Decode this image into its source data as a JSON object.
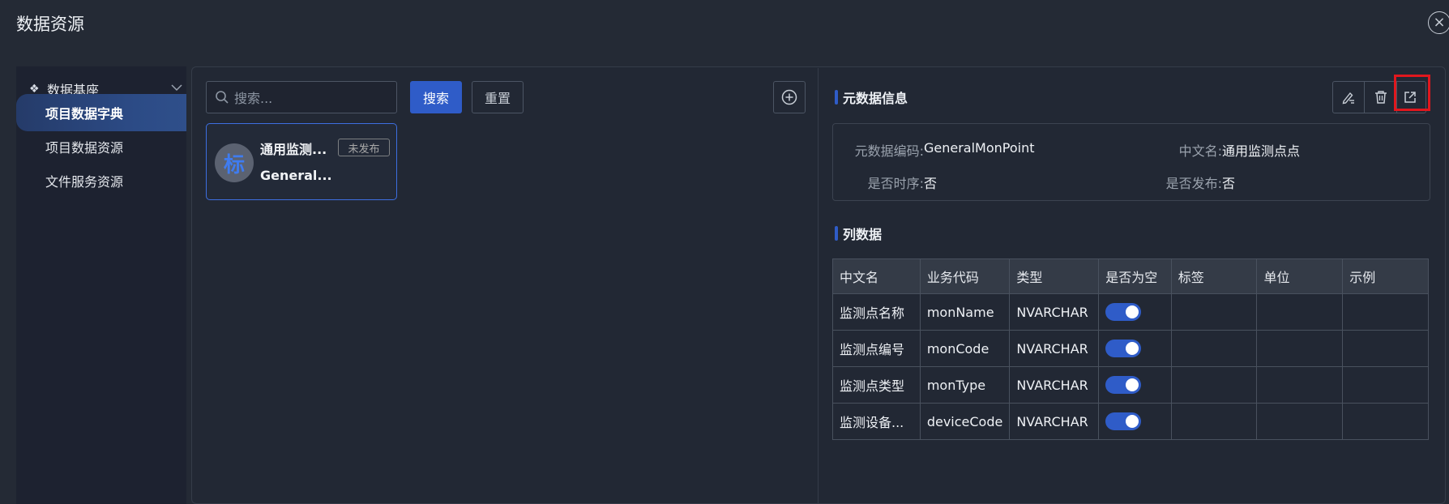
{
  "window": {
    "title": "数据资源"
  },
  "sidebar": {
    "header": "数据基座",
    "items": [
      {
        "label": "项目数据字典",
        "active": true
      },
      {
        "label": "项目数据资源",
        "active": false
      },
      {
        "label": "文件服务资源",
        "active": false
      }
    ]
  },
  "search": {
    "placeholder": "搜索...",
    "search_label": "搜索",
    "reset_label": "重置"
  },
  "card": {
    "avatar_char": "标",
    "name": "通用监测...",
    "code": "General...",
    "status": "未发布"
  },
  "meta": {
    "title": "元数据信息",
    "code_label": "元数据编码:",
    "code_value": "GeneralMonPoint",
    "cn_label": "中文名:",
    "cn_value": "通用监测点点",
    "timeseq_label": "是否时序:",
    "timeseq_value": "否",
    "published_label": "是否发布:",
    "published_value": "否"
  },
  "columns": {
    "title": "列数据",
    "headers": [
      "中文名",
      "业务代码",
      "类型",
      "是否为空",
      "标签",
      "单位",
      "示例"
    ],
    "rows": [
      {
        "cn": "监测点名称",
        "code": "monName",
        "type": "NVARCHAR",
        "nullable": true,
        "tag": "",
        "unit": "",
        "example": ""
      },
      {
        "cn": "监测点编号",
        "code": "monCode",
        "type": "NVARCHAR",
        "nullable": true,
        "tag": "",
        "unit": "",
        "example": ""
      },
      {
        "cn": "监测点类型",
        "code": "monType",
        "type": "NVARCHAR",
        "nullable": true,
        "tag": "",
        "unit": "",
        "example": ""
      },
      {
        "cn": "监测设备...",
        "code": "deviceCode",
        "type": "NVARCHAR",
        "nullable": true,
        "tag": "",
        "unit": "",
        "example": ""
      }
    ]
  },
  "colors": {
    "accent": "#2f5cc8",
    "background": "#242a35",
    "highlight": "#e1171d"
  },
  "icons": [
    "close-icon",
    "dropbox-icon",
    "chevron-down-icon",
    "search-icon",
    "plus-circle-icon",
    "edit-icon",
    "trash-icon",
    "external-link-icon"
  ]
}
